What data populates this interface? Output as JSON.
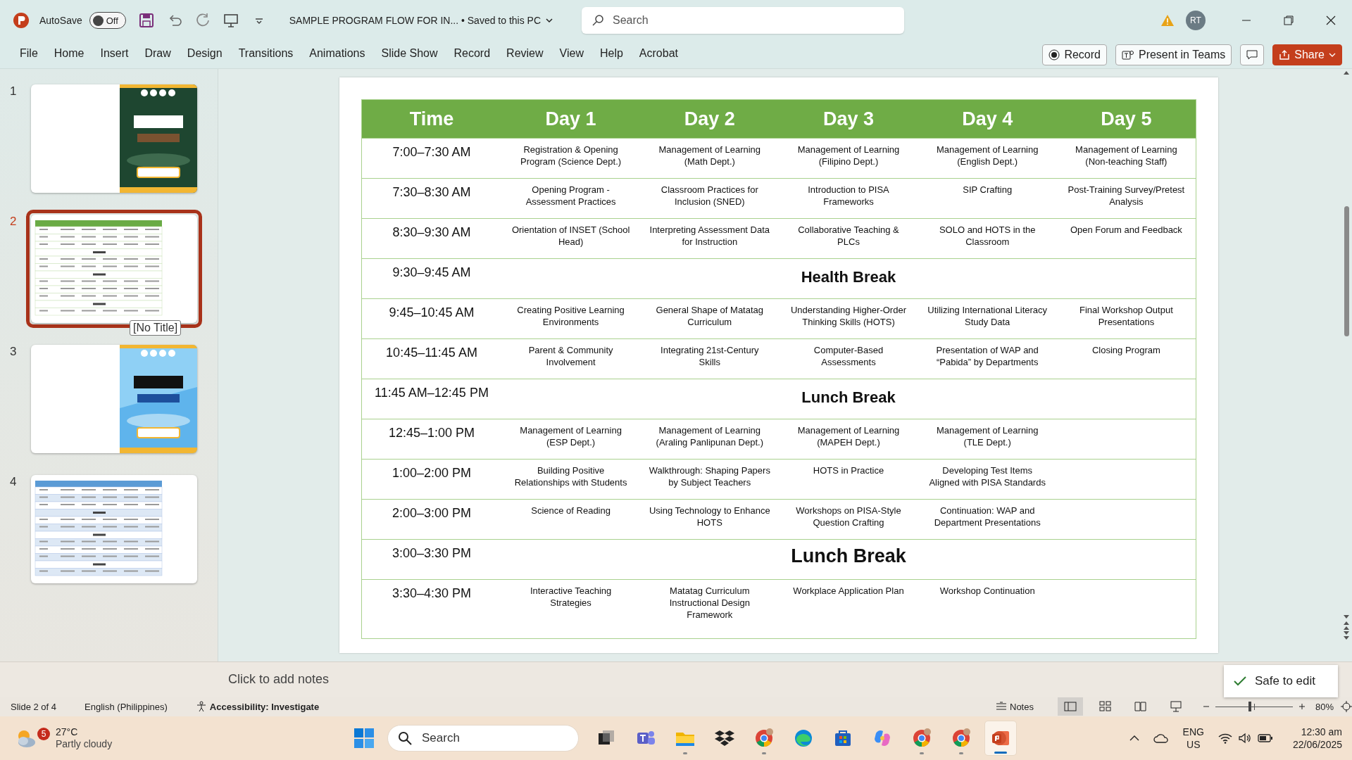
{
  "title_bar": {
    "autosave_label": "AutoSave",
    "autosave": {
      "on": false,
      "label": "Off"
    },
    "document_title": "SAMPLE PROGRAM FLOW FOR IN... • Saved to this PC",
    "search_placeholder": "Search",
    "avatar": "RT"
  },
  "ribbon_tabs": [
    {
      "label": "File",
      "selected": false
    },
    {
      "label": "Home",
      "selected": false
    },
    {
      "label": "Insert",
      "selected": false
    },
    {
      "label": "Draw",
      "selected": false
    },
    {
      "label": "Design",
      "selected": false
    },
    {
      "label": "Transitions",
      "selected": false
    },
    {
      "label": "Animations",
      "selected": false
    },
    {
      "label": "Slide Show",
      "selected": false
    },
    {
      "label": "Record",
      "selected": false
    },
    {
      "label": "Review",
      "selected": false
    },
    {
      "label": "View",
      "selected": false
    },
    {
      "label": "Help",
      "selected": false
    },
    {
      "label": "Acrobat",
      "selected": false
    }
  ],
  "ribbon_buttons": [
    {
      "kind": "record",
      "label": "Record"
    },
    {
      "kind": "teams",
      "label": "Present in Teams"
    },
    {
      "kind": "comment"
    },
    {
      "kind": "share",
      "label": "Share"
    }
  ],
  "slides": [
    {
      "number": "1",
      "kind": "cover",
      "selected": false
    },
    {
      "number": "2",
      "kind": "table",
      "selected": true,
      "tooltip": "[No Title]"
    },
    {
      "number": "3",
      "kind": "cover",
      "selected": false
    },
    {
      "number": "4",
      "kind": "table",
      "selected": false
    }
  ],
  "slide": {
    "table": {
      "columns": [
        "Time",
        "Day 1",
        "Day 2",
        "Day 3",
        "Day 4",
        "Day 5"
      ],
      "rows": [
        {
          "kind": "session",
          "time": "7:00–7:30 AM",
          "cells": [
            "Registration & Opening Program (Science Dept.)",
            "Management of Learning (Math Dept.)",
            "Management of Learning (Filipino Dept.)",
            "Management of Learning (English Dept.)",
            "Management of Learning (Non-teaching Staff)"
          ]
        },
        {
          "kind": "session",
          "time": "7:30–8:30 AM",
          "cells": [
            "Opening Program - Assessment Practices",
            "Classroom Practices for Inclusion (SNED)",
            "Introduction to PISA Frameworks",
            "SIP Crafting",
            "Post-Training Survey/Pretest Analysis"
          ]
        },
        {
          "kind": "session",
          "time": "8:30–9:30 AM",
          "cells": [
            "Orientation of INSET (School Head)",
            "Interpreting Assessment Data for Instruction",
            "Collaborative Teaching & PLCs",
            "SOLO and HOTS in the Classroom",
            "Open Forum and Feedback"
          ]
        },
        {
          "kind": "break",
          "time": "9:30–9:45 AM",
          "label": "Health Break",
          "large": false
        },
        {
          "kind": "session",
          "time": "9:45–10:45 AM",
          "cells": [
            "Creating Positive Learning Environments",
            "General Shape of Matatag Curriculum",
            "Understanding Higher-Order Thinking Skills (HOTS)",
            "Utilizing International Literacy Study Data",
            "Final Workshop Output Presentations"
          ]
        },
        {
          "kind": "session",
          "time": "10:45–11:45 AM",
          "cells": [
            "Parent & Community Involvement",
            "Integrating 21st-Century Skills",
            "Computer-Based Assessments",
            "Presentation of WAP and “Pabida” by Departments",
            "Closing Program"
          ]
        },
        {
          "kind": "break",
          "time": "11:45 AM–12:45 PM",
          "label": "Lunch Break",
          "large": false
        },
        {
          "kind": "session",
          "time": "12:45–1:00 PM",
          "cells": [
            "Management of Learning (ESP Dept.)",
            "Management of Learning (Araling Panlipunan Dept.)",
            "Management of Learning (MAPEH Dept.)",
            "Management of Learning (TLE Dept.)"
          ]
        },
        {
          "kind": "session",
          "time": "1:00–2:00 PM",
          "cells": [
            "Building Positive Relationships with Students",
            "Walkthrough: Shaping Papers by Subject Teachers",
            "HOTS in Practice",
            "Developing Test Items Aligned with PISA Standards"
          ]
        },
        {
          "kind": "session",
          "time": "2:00–3:00 PM",
          "cells": [
            "Science of Reading",
            "Using Technology to Enhance HOTS",
            "Workshops on PISA-Style Question Crafting",
            "Continuation: WAP and Department Presentations"
          ]
        },
        {
          "kind": "break",
          "time": "3:00–3:30 PM",
          "label": "Lunch Break",
          "large": true
        },
        {
          "kind": "session",
          "time": "3:30–4:30 PM",
          "cells": [
            "Interactive Teaching Strategies",
            "Matatag Curriculum Instructional Design Framework",
            "Workplace Application Plan",
            "Workshop Continuation"
          ]
        }
      ]
    }
  },
  "notes_placeholder": "Click to add notes",
  "toast": "Safe to edit",
  "status_bar": {
    "slide_info": "Slide 2 of 4",
    "language": "English (Philippines)",
    "accessibility": "Accessibility: Investigate",
    "notes": "Notes",
    "views": [
      {
        "kind": "normal",
        "selected": true
      },
      {
        "kind": "sorter",
        "selected": false
      },
      {
        "kind": "reading",
        "selected": false
      },
      {
        "kind": "slideshow",
        "selected": false
      }
    ],
    "zoom": {
      "level": 0.45,
      "label": "80%"
    }
  },
  "taskbar": {
    "weather": {
      "badge": "5",
      "temperature": "27°C",
      "condition": "Partly cloudy"
    },
    "search_placeholder": "Search",
    "apps": [
      {
        "kind": "taskview",
        "running": false,
        "active": false
      },
      {
        "kind": "teams",
        "running": false,
        "active": false
      },
      {
        "kind": "explorer",
        "running": true,
        "active": false
      },
      {
        "kind": "dropbox",
        "running": false,
        "active": false
      },
      {
        "kind": "chrome",
        "running": true,
        "active": false
      },
      {
        "kind": "edge",
        "running": false,
        "active": false
      },
      {
        "kind": "store",
        "running": false,
        "active": false
      },
      {
        "kind": "copilot",
        "running": false,
        "active": false
      },
      {
        "kind": "chrome",
        "running": true,
        "active": false
      },
      {
        "kind": "chrome",
        "running": true,
        "active": false
      },
      {
        "kind": "powerpoint",
        "running": true,
        "active": true
      }
    ],
    "language": "ENG",
    "region": "US",
    "time": "12:30 am",
    "date": "22/06/2025"
  }
}
